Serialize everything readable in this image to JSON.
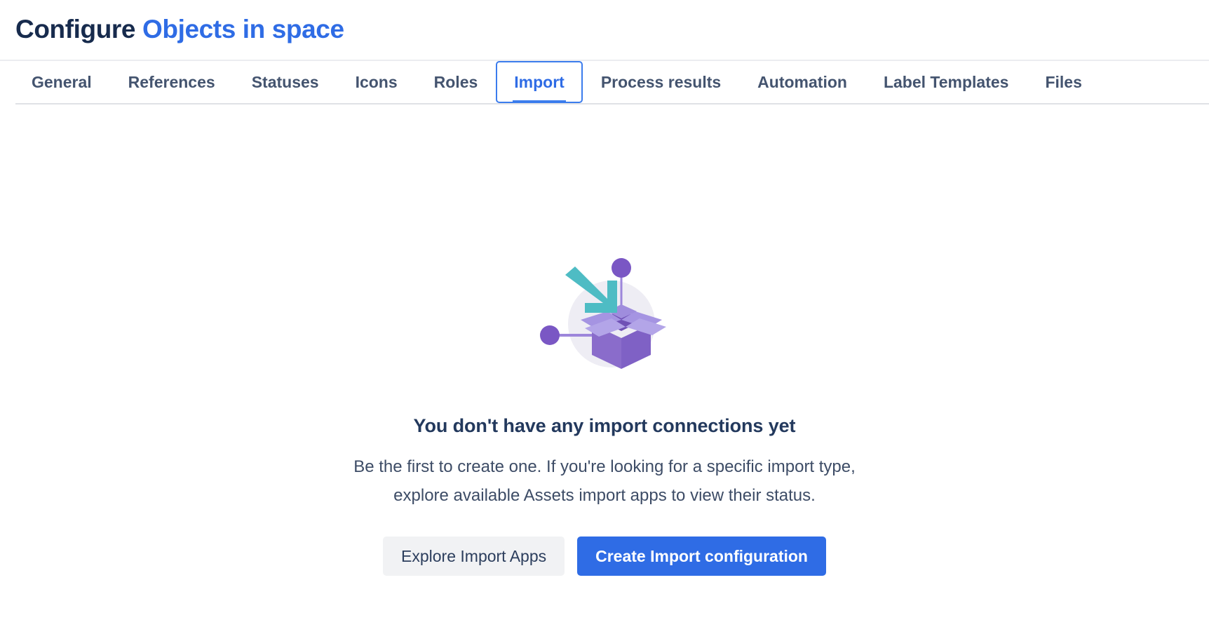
{
  "header": {
    "title_static": "Configure ",
    "title_link": "Objects in space",
    "link_color": "#2f6ce5",
    "static_color": "#172b4d"
  },
  "tabs": {
    "active": "Import",
    "items": [
      {
        "label": "General"
      },
      {
        "label": "References"
      },
      {
        "label": "Statuses"
      },
      {
        "label": "Icons"
      },
      {
        "label": "Roles"
      },
      {
        "label": "Import"
      },
      {
        "label": "Process results"
      },
      {
        "label": "Automation"
      },
      {
        "label": "Label Templates"
      },
      {
        "label": "Files"
      }
    ]
  },
  "empty_state": {
    "illustration_name": "open-box-import-illustration",
    "heading": "You don't have any import connections yet",
    "body_line1": "Be the first to create one. If you're looking for a specific import type,",
    "body_line2": "explore available Assets import apps to view their status.",
    "secondary_button": "Explore Import Apps",
    "primary_button": "Create Import configuration",
    "colors": {
      "box_dark_purple": "#7e62c8",
      "box_light_purple": "#a394e0",
      "dot_purple": "#7a57c4",
      "arrow_teal": "#4ebcc4",
      "circle_bg": "#eeedf4",
      "primary_button_bg": "#2f6ce5",
      "secondary_button_bg": "#f1f2f4"
    }
  }
}
